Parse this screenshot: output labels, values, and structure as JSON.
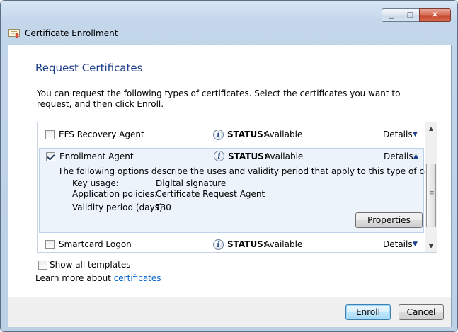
{
  "window": {
    "title": "Certificate Enrollment",
    "controls": {
      "minimize": "▁",
      "maximize": "□",
      "close": "✕"
    }
  },
  "page": {
    "heading": "Request Certificates",
    "intro": "You can request the following types of certificates. Select the certificates you want to request, and then click Enroll."
  },
  "certificates": [
    {
      "name": "EFS Recovery Agent",
      "checked": false,
      "status_label": "STATUS:",
      "status_value": "Available",
      "details_label": "Details",
      "expanded": false
    },
    {
      "name": "Enrollment Agent",
      "checked": true,
      "status_label": "STATUS:",
      "status_value": "Available",
      "details_label": "Details",
      "expanded": true,
      "description": "The following options describe the uses and validity period that apply to this type of certificate:",
      "key_usage_label": "Key usage:",
      "key_usage_value": "Digital signature",
      "app_policies_label": "Application policies:",
      "app_policies_value": "Certificate Request Agent",
      "validity_label": "Validity period (days):",
      "validity_value": "730",
      "properties_button": "Properties"
    },
    {
      "name": "Smartcard Logon",
      "checked": false,
      "status_label": "STATUS:",
      "status_value": "Available",
      "details_label": "Details",
      "expanded": false
    }
  ],
  "options": {
    "show_all_templates": "Show all templates",
    "learn_more_prefix": "Learn more about",
    "learn_more_link": "certificates"
  },
  "footer": {
    "enroll_button": "Enroll",
    "cancel_button": "Cancel"
  },
  "icons": {
    "status": "info-icon",
    "expand": "chevron-down-icon",
    "collapse": "chevron-up-icon"
  },
  "colors": {
    "heading": "#1e3f8a",
    "link": "#0066cc",
    "expanded_row": "#ecf3fb"
  }
}
